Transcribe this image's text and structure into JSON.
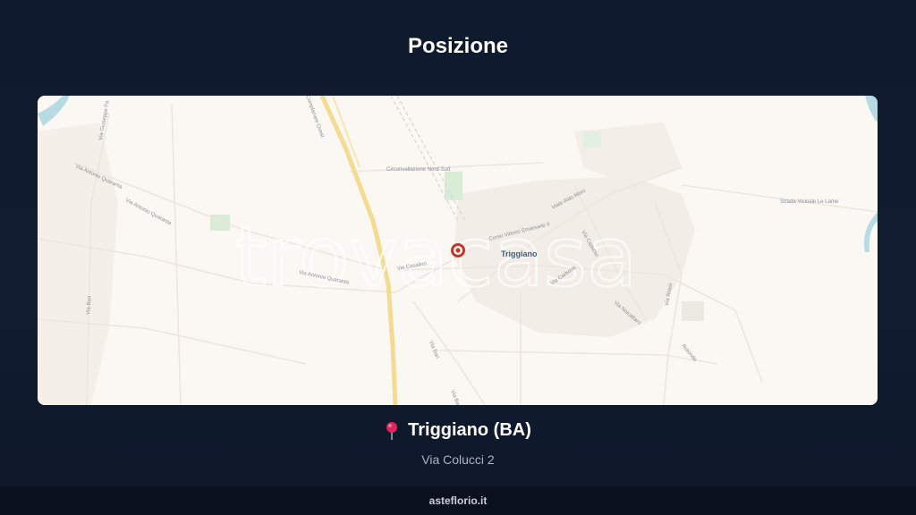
{
  "page": {
    "title": "Posizione"
  },
  "map": {
    "town": "Triggiano",
    "watermark": "trovacasa",
    "streets": {
      "circonvallazione": "Circonvallazione Nord-Sud",
      "corso": "Corso Vittorio Emanuele II",
      "aldo_moro": "Viale Aldo Moro",
      "casalino": "Via Casalino",
      "quaranta_a": "Via Antonio Quaranta",
      "quaranta_b": "Via Antonio Quaranta",
      "quaranta_c": "Via Antonio Quaranta",
      "bari_left": "Via Bari",
      "bari_center": "Via Bari",
      "bari_low": "Via Bari",
      "giuseppe": "Via Giuseppe Fa",
      "complanare": "Complanare Ovest",
      "capurso": "Via Capurso",
      "carbone": "Via Carbone",
      "noicattaro": "Via Noicattaro",
      "rotonda": "Rotonda",
      "vicinale": "Strada Vicinale Le Lame",
      "rossi": "Via Rossi"
    },
    "colors": {
      "background": "#fbf7f3",
      "highway": "#f1d98a",
      "marker": "#c0392b",
      "park": "#cfe6cf"
    }
  },
  "location": {
    "pin_icon": "round-pushpin-icon",
    "title": "Triggiano (BA)",
    "address": "Via Colucci 2"
  },
  "footer": {
    "text": "asteflorio.it"
  }
}
